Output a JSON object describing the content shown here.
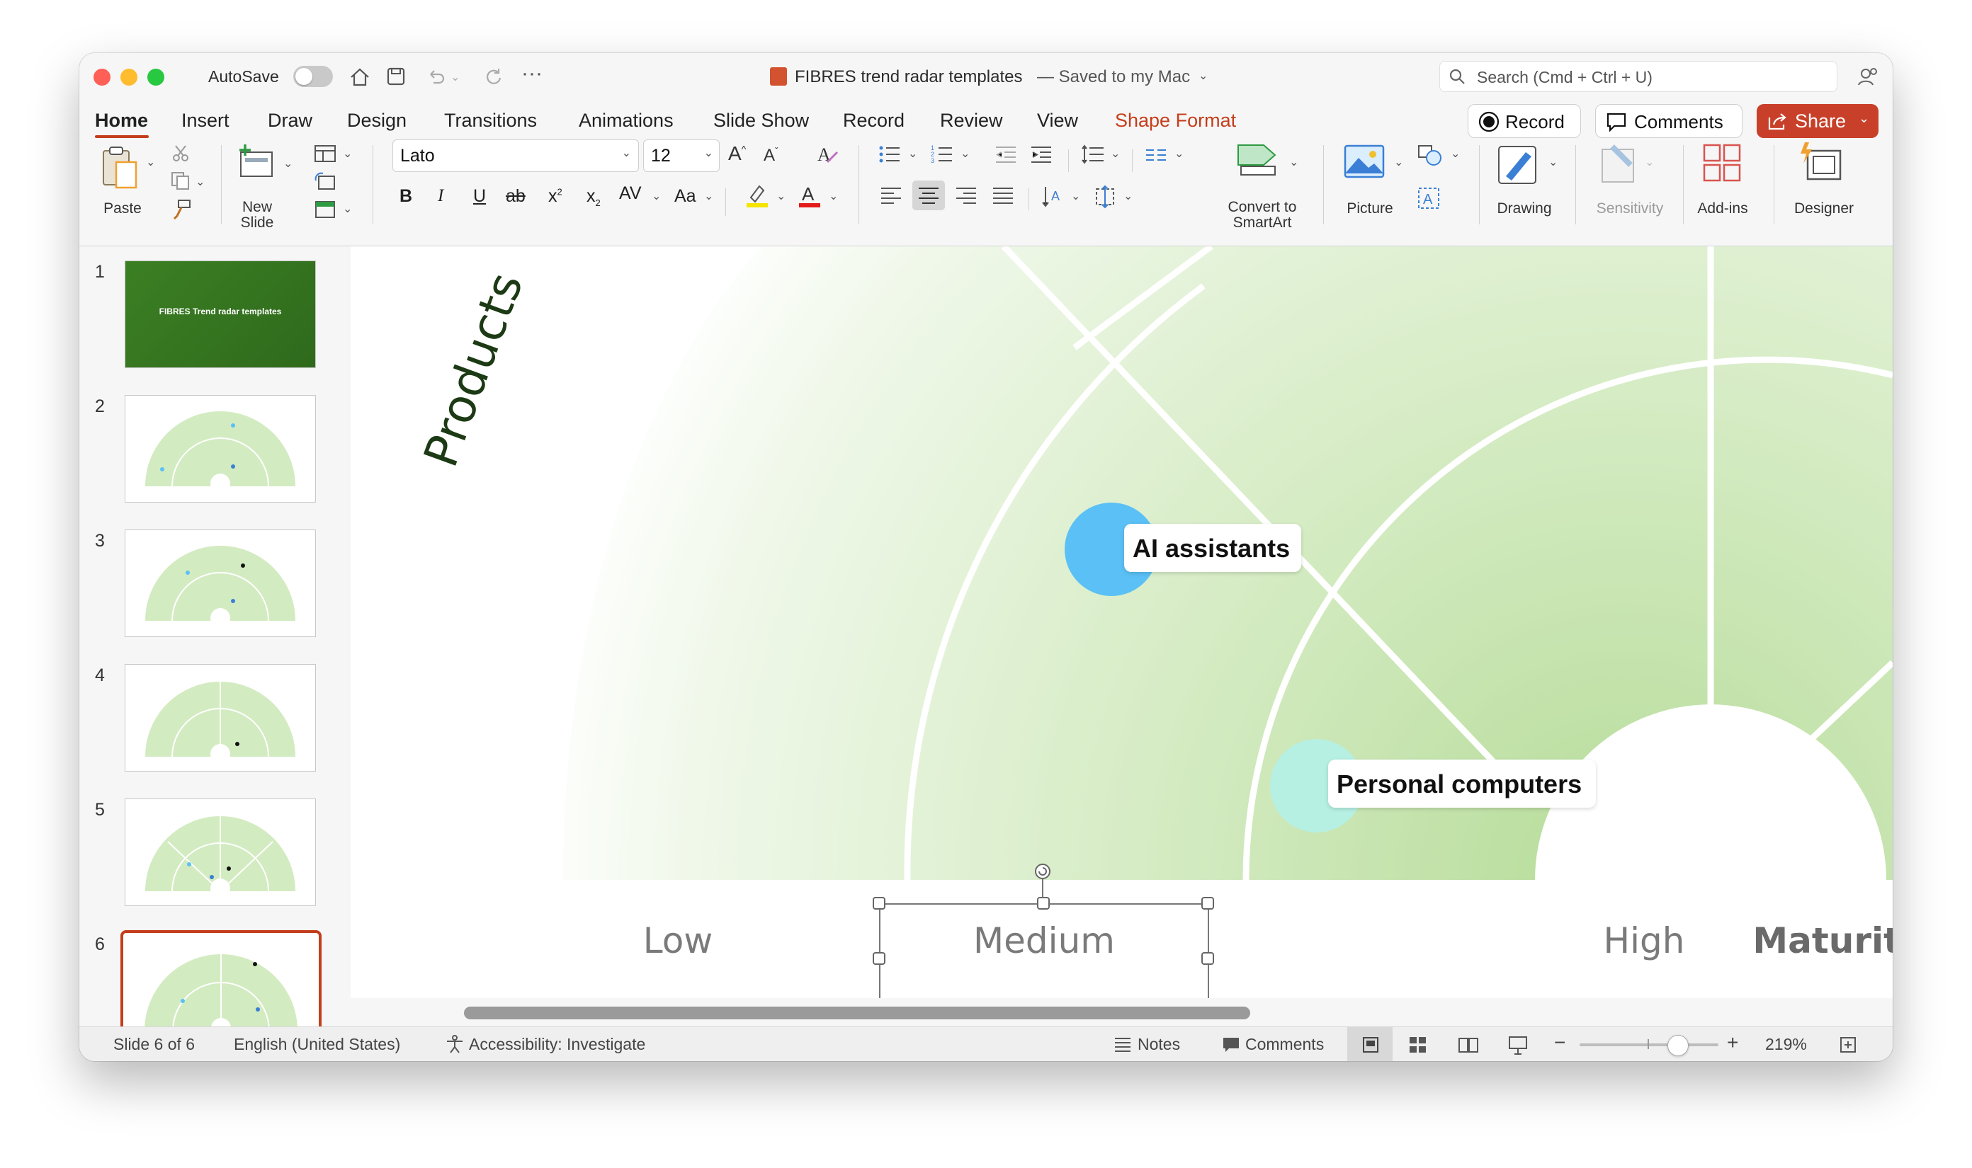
{
  "window": {
    "title": "FIBRES trend radar templates",
    "save_status": "— Saved to my Mac",
    "autosave_label": "AutoSave",
    "search_placeholder": "Search (Cmd + Ctrl + U)"
  },
  "tabs": [
    "Home",
    "Insert",
    "Draw",
    "Design",
    "Transitions",
    "Animations",
    "Slide Show",
    "Record",
    "Review",
    "View",
    "Shape Format"
  ],
  "active_tab": "Home",
  "header_buttons": {
    "record": "Record",
    "comments": "Comments",
    "share": "Share"
  },
  "ribbon": {
    "paste": "Paste",
    "new_slide_1": "New",
    "new_slide_2": "Slide",
    "font_name": "Lato",
    "font_size": "12",
    "convert_1": "Convert to",
    "convert_2": "SmartArt",
    "picture": "Picture",
    "drawing": "Drawing",
    "sensitivity": "Sensitivity",
    "addins": "Add-ins",
    "designer": "Designer",
    "bold": "B",
    "italic": "I",
    "underline": "U",
    "strike": "ab",
    "superscript": "x",
    "subscript": "x",
    "case": "Aa",
    "spacing": "AV"
  },
  "slides": [
    {
      "num": "1",
      "title": "FIBRES Trend radar templates"
    },
    {
      "num": "2"
    },
    {
      "num": "3"
    },
    {
      "num": "4"
    },
    {
      "num": "5"
    },
    {
      "num": "6"
    }
  ],
  "slide": {
    "products_label": "Products",
    "bubble1": "AI assistants",
    "bubble2": "Personal computers",
    "axis": [
      "Low",
      "Medium",
      "High",
      "Maturity"
    ]
  },
  "status": {
    "slide_of": "Slide 6 of 6",
    "language": "English (United States)",
    "accessibility": "Accessibility: Investigate",
    "notes": "Notes",
    "comments": "Comments",
    "zoom": "219%"
  },
  "colors": {
    "accent": "#c43e1c",
    "bubble_blue": "#5bc0f5",
    "bubble_mint": "#b6f0e2",
    "radar_green": "#c9e6b4",
    "share_red": "#c8402a"
  }
}
